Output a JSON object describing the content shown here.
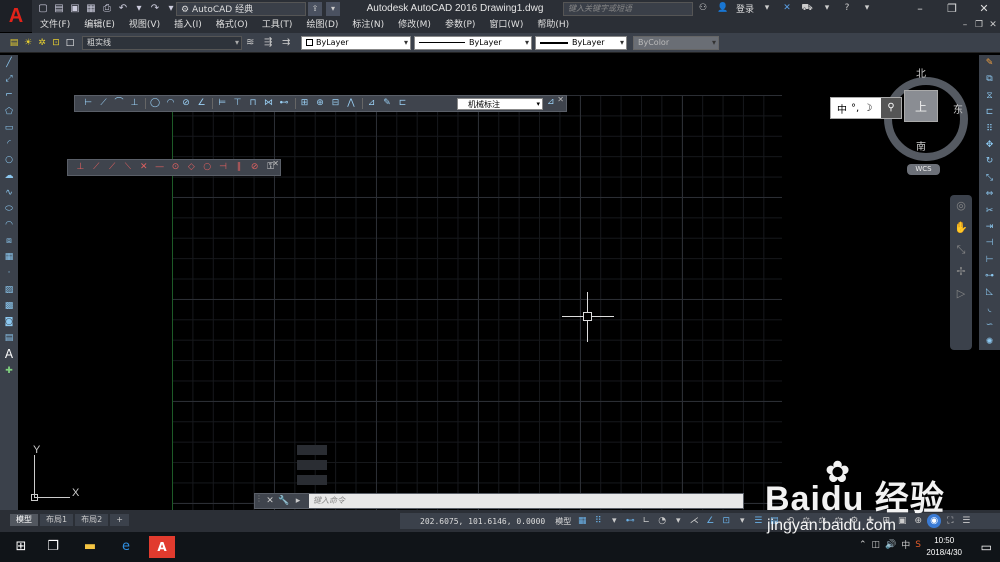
{
  "titlebar": {
    "workspace": "AutoCAD 经典",
    "title": "Autodesk AutoCAD 2016    Drawing1.dwg",
    "search_placeholder": "键入关键字或短语",
    "login": "登录"
  },
  "menu": {
    "items": [
      "文件(F)",
      "编辑(E)",
      "视图(V)",
      "插入(I)",
      "格式(O)",
      "工具(T)",
      "绘图(D)",
      "标注(N)",
      "修改(M)",
      "参数(P)",
      "窗口(W)",
      "帮助(H)"
    ]
  },
  "properties": {
    "layer": "粗实线",
    "color": "ByLayer",
    "linetype": "ByLayer",
    "lineweight": "ByLayer",
    "plotstyle": "ByColor"
  },
  "dim_toolbar": {
    "style": "机械标注"
  },
  "viewcube": {
    "north": "北",
    "south": "南",
    "east": "东",
    "face": "上",
    "wcs": "WCS"
  },
  "ime": {
    "lang": "中"
  },
  "ucs": {
    "x": "X",
    "y": "Y"
  },
  "command": {
    "placeholder": "键入命令"
  },
  "status": {
    "tabs": [
      "模型",
      "布局1",
      "布局2"
    ],
    "coords": "202.6075, 101.6146, 0.0000",
    "mode": "模型"
  },
  "taskbar": {
    "time": "10:50",
    "date": "2018/4/30",
    "ime": "中"
  },
  "watermark": {
    "brand": "Baidu 经验",
    "url": "jingyan.baidu.com"
  },
  "colors": {
    "accent_red": "#e13b2e",
    "chrome": "#3b414b",
    "canvas": "#000000"
  }
}
